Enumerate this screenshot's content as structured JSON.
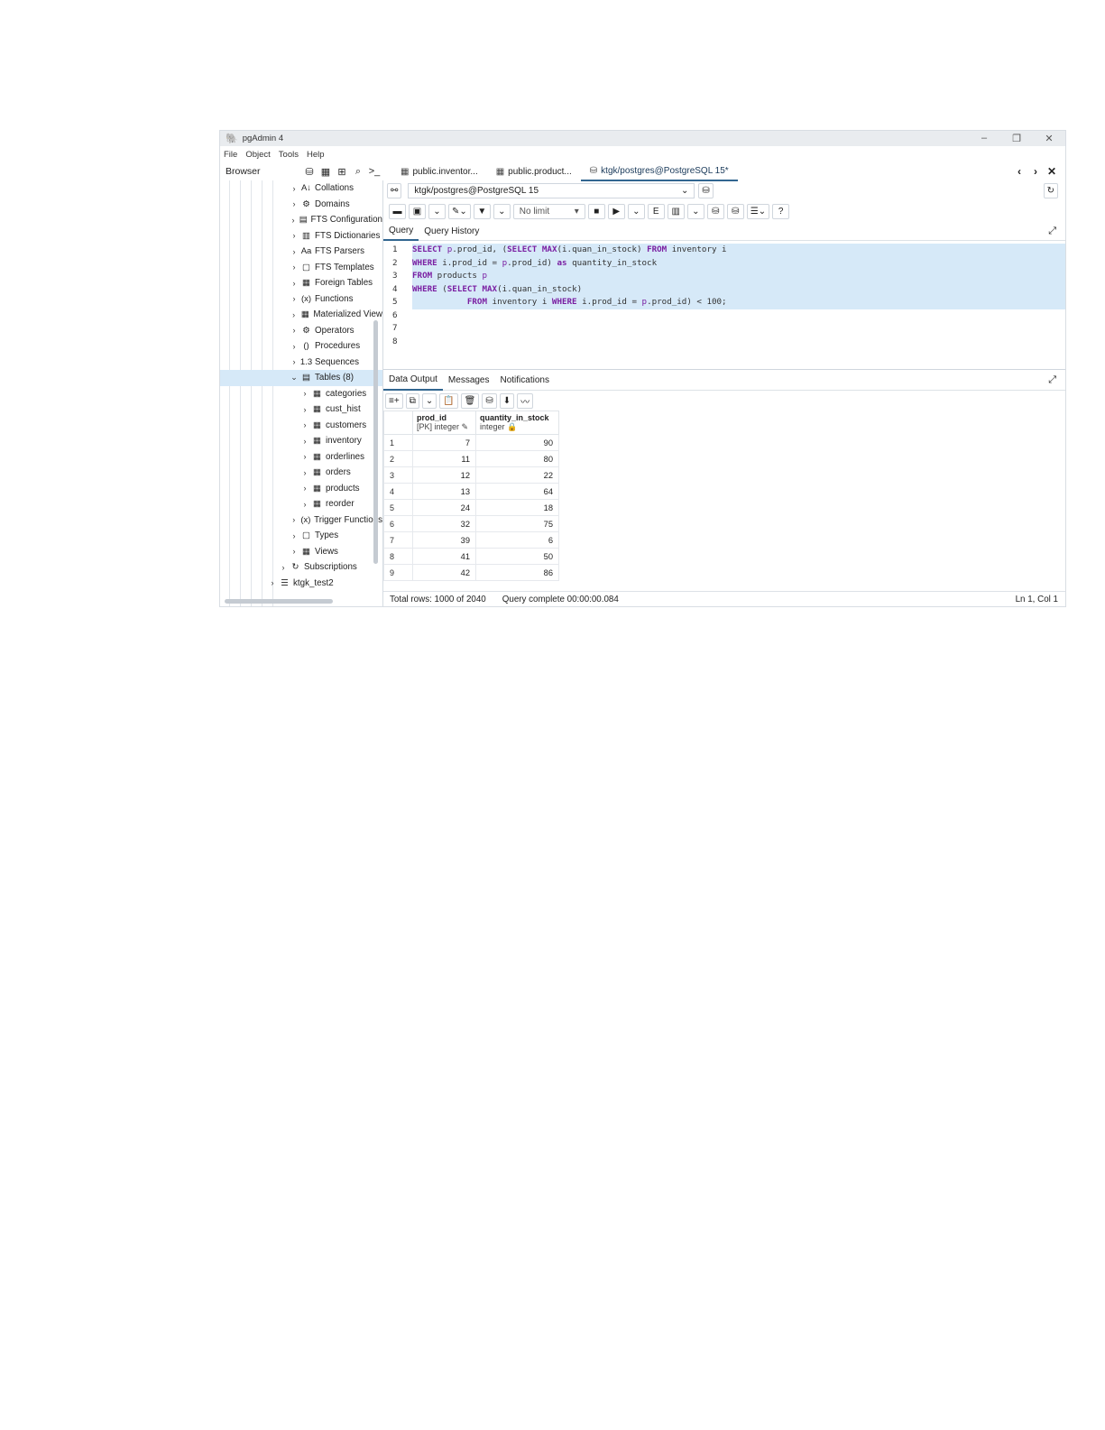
{
  "window": {
    "title": "pgAdmin 4",
    "controls": {
      "minimize": "–",
      "maximize": "❐",
      "close": "✕"
    }
  },
  "menu": [
    "File",
    "Object",
    "Tools",
    "Help"
  ],
  "browser": {
    "label": "Browser"
  },
  "tabs": [
    {
      "label": "public.inventor...",
      "icon": "table-icon"
    },
    {
      "label": "public.product...",
      "icon": "table-icon"
    },
    {
      "label": "ktgk/postgres@PostgreSQL 15*",
      "icon": "database-icon",
      "active": true
    }
  ],
  "tree": [
    {
      "label": "Collations",
      "icon": "A↓",
      "depth": 3,
      "chev": "›"
    },
    {
      "label": "Domains",
      "icon": "⚙",
      "depth": 3,
      "chev": "›"
    },
    {
      "label": "FTS Configuration",
      "icon": "▤",
      "depth": 3,
      "chev": "›"
    },
    {
      "label": "FTS Dictionaries",
      "icon": "▥",
      "depth": 3,
      "chev": "›"
    },
    {
      "label": "FTS Parsers",
      "icon": "Aa",
      "depth": 3,
      "chev": "›"
    },
    {
      "label": "FTS Templates",
      "icon": "▢",
      "depth": 3,
      "chev": "›"
    },
    {
      "label": "Foreign Tables",
      "icon": "▦",
      "depth": 3,
      "chev": "›"
    },
    {
      "label": "Functions",
      "icon": "(x)",
      "depth": 3,
      "chev": "›"
    },
    {
      "label": "Materialized View",
      "icon": "▦",
      "depth": 3,
      "chev": "›"
    },
    {
      "label": "Operators",
      "icon": "⚙",
      "depth": 3,
      "chev": "›"
    },
    {
      "label": "Procedures",
      "icon": "()",
      "depth": 3,
      "chev": "›"
    },
    {
      "label": "Sequences",
      "icon": "1.3",
      "depth": 3,
      "chev": "›"
    },
    {
      "label": "Tables (8)",
      "icon": "▤",
      "depth": 3,
      "chev": "⌄",
      "selected": true
    },
    {
      "label": "categories",
      "icon": "▦",
      "depth": 4,
      "chev": "›"
    },
    {
      "label": "cust_hist",
      "icon": "▦",
      "depth": 4,
      "chev": "›"
    },
    {
      "label": "customers",
      "icon": "▦",
      "depth": 4,
      "chev": "›"
    },
    {
      "label": "inventory",
      "icon": "▦",
      "depth": 4,
      "chev": "›"
    },
    {
      "label": "orderlines",
      "icon": "▦",
      "depth": 4,
      "chev": "›"
    },
    {
      "label": "orders",
      "icon": "▦",
      "depth": 4,
      "chev": "›"
    },
    {
      "label": "products",
      "icon": "▦",
      "depth": 4,
      "chev": "›"
    },
    {
      "label": "reorder",
      "icon": "▦",
      "depth": 4,
      "chev": "›"
    },
    {
      "label": "Trigger Functions",
      "icon": "(x)",
      "depth": 3,
      "chev": "›"
    },
    {
      "label": "Types",
      "icon": "▢",
      "depth": 3,
      "chev": "›"
    },
    {
      "label": "Views",
      "icon": "▦",
      "depth": 3,
      "chev": "›"
    },
    {
      "label": "Subscriptions",
      "icon": "↻",
      "depth": 2,
      "chev": "›"
    },
    {
      "label": "ktgk_test2",
      "icon": "☰",
      "depth": 1,
      "chev": "›"
    }
  ],
  "connection": {
    "value": "ktgk/postgres@PostgreSQL 15"
  },
  "toolbar": {
    "limit": "No limit"
  },
  "query_tabs": {
    "query": "Query",
    "history": "Query History"
  },
  "editor": {
    "line_numbers": [
      "1",
      "2",
      "3",
      "4",
      "5",
      "6",
      "7",
      "8"
    ],
    "lines": [
      [
        [
          "kw",
          "SELECT "
        ],
        [
          "var",
          "p"
        ],
        [
          "ot",
          ".prod_id, ("
        ],
        [
          "kw",
          "SELECT "
        ],
        [
          "fn",
          "MAX"
        ],
        [
          "ot",
          "(i.quan_in_stock) "
        ],
        [
          "kw",
          "FROM"
        ],
        [
          "ot",
          " inventory i"
        ]
      ],
      [
        [
          "kw",
          "WHERE "
        ],
        [
          "ot",
          "i.prod_id = "
        ],
        [
          "var",
          "p"
        ],
        [
          "ot",
          ".prod_id) "
        ],
        [
          "kw",
          "as"
        ],
        [
          "ot",
          " quantity_in_stock"
        ]
      ],
      [
        [
          "kw",
          "FROM"
        ],
        [
          "ot",
          " products "
        ],
        [
          "var",
          "p"
        ]
      ],
      [
        [
          "kw",
          "WHERE"
        ],
        [
          "ot",
          " ("
        ],
        [
          "kw",
          "SELECT "
        ],
        [
          "fn",
          "MAX"
        ],
        [
          "ot",
          "(i.quan_in_stock)"
        ]
      ],
      [
        [
          "ot",
          "           "
        ],
        [
          "kw",
          "FROM"
        ],
        [
          "ot",
          " inventory i "
        ],
        [
          "kw",
          "WHERE"
        ],
        [
          "ot",
          " i.prod_id = "
        ],
        [
          "var",
          "p"
        ],
        [
          "ot",
          ".prod_id) < 100;"
        ]
      ],
      [],
      [],
      []
    ]
  },
  "result_tabs": {
    "data": "Data Output",
    "messages": "Messages",
    "notifications": "Notifications"
  },
  "grid": {
    "columns": [
      {
        "name": "prod_id",
        "type": "[PK] integer"
      },
      {
        "name": "quantity_in_stock",
        "type": "integer"
      }
    ],
    "rows": [
      [
        "1",
        "7",
        "90"
      ],
      [
        "2",
        "11",
        "80"
      ],
      [
        "3",
        "12",
        "22"
      ],
      [
        "4",
        "13",
        "64"
      ],
      [
        "5",
        "24",
        "18"
      ],
      [
        "6",
        "32",
        "75"
      ],
      [
        "7",
        "39",
        "6"
      ],
      [
        "8",
        "41",
        "50"
      ],
      [
        "9",
        "42",
        "86"
      ]
    ]
  },
  "status": {
    "rows": "Total rows: 1000 of 2040",
    "query": "Query complete 00:00:00.084",
    "position": "Ln 1, Col 1"
  }
}
